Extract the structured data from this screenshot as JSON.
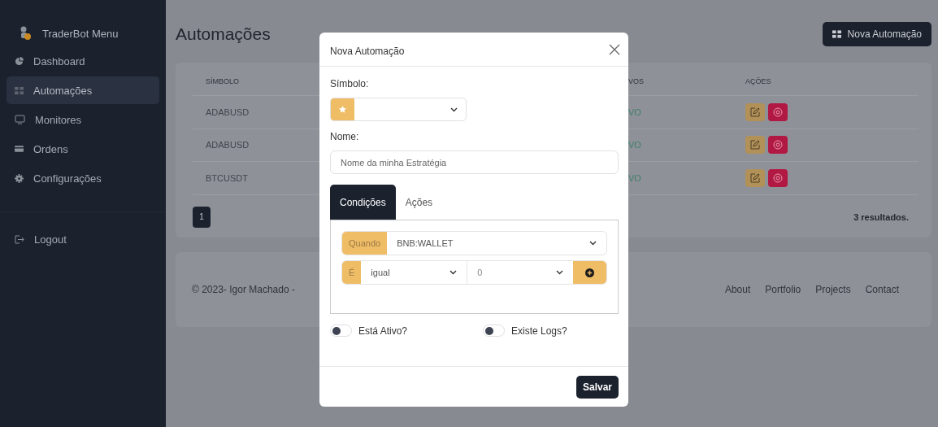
{
  "sidebar": {
    "brand": "TraderBot Menu",
    "items": [
      {
        "label": "Dashboard",
        "selected": false
      },
      {
        "label": "Automações",
        "selected": true
      },
      {
        "label": "Monitores",
        "selected": false
      },
      {
        "label": "Ordens",
        "selected": false
      },
      {
        "label": "Configurações",
        "selected": false
      }
    ],
    "logout": "Logout"
  },
  "page": {
    "title": "Automações",
    "new_button": "Nova Automação"
  },
  "table": {
    "columns": [
      "SÍMBOLO",
      "VOS",
      "AÇÕES"
    ],
    "rows": [
      {
        "symbol": "ADABUSD",
        "status": "VO"
      },
      {
        "symbol": "ADABUSD",
        "status": "VO"
      },
      {
        "symbol": "BTCUSDT",
        "status": "VO"
      }
    ],
    "pages": [
      {
        "label": "1",
        "selected": true
      }
    ],
    "results": "3 resultados."
  },
  "footer": {
    "copyright": "© 2023- Igor Machado -",
    "links": [
      "About",
      "Portfolio",
      "Projects",
      "Contact"
    ]
  },
  "modal": {
    "title": "Nova Automação",
    "symbol_label": "Símbolo:",
    "name_label": "Nome:",
    "name_placeholder": "Nome da minha Estratégia",
    "tabs": [
      {
        "label": "Condições",
        "selected": true
      },
      {
        "label": "Ações",
        "selected": false
      }
    ],
    "when_label": "Quando",
    "when_value": "BNB:WALLET",
    "is_label": "É",
    "operator": "igual",
    "value": "0",
    "toggles": [
      {
        "label": "Está Ativo?",
        "on": false
      },
      {
        "label": "Existe Logs?",
        "on": false
      }
    ],
    "save": "Salvar"
  }
}
